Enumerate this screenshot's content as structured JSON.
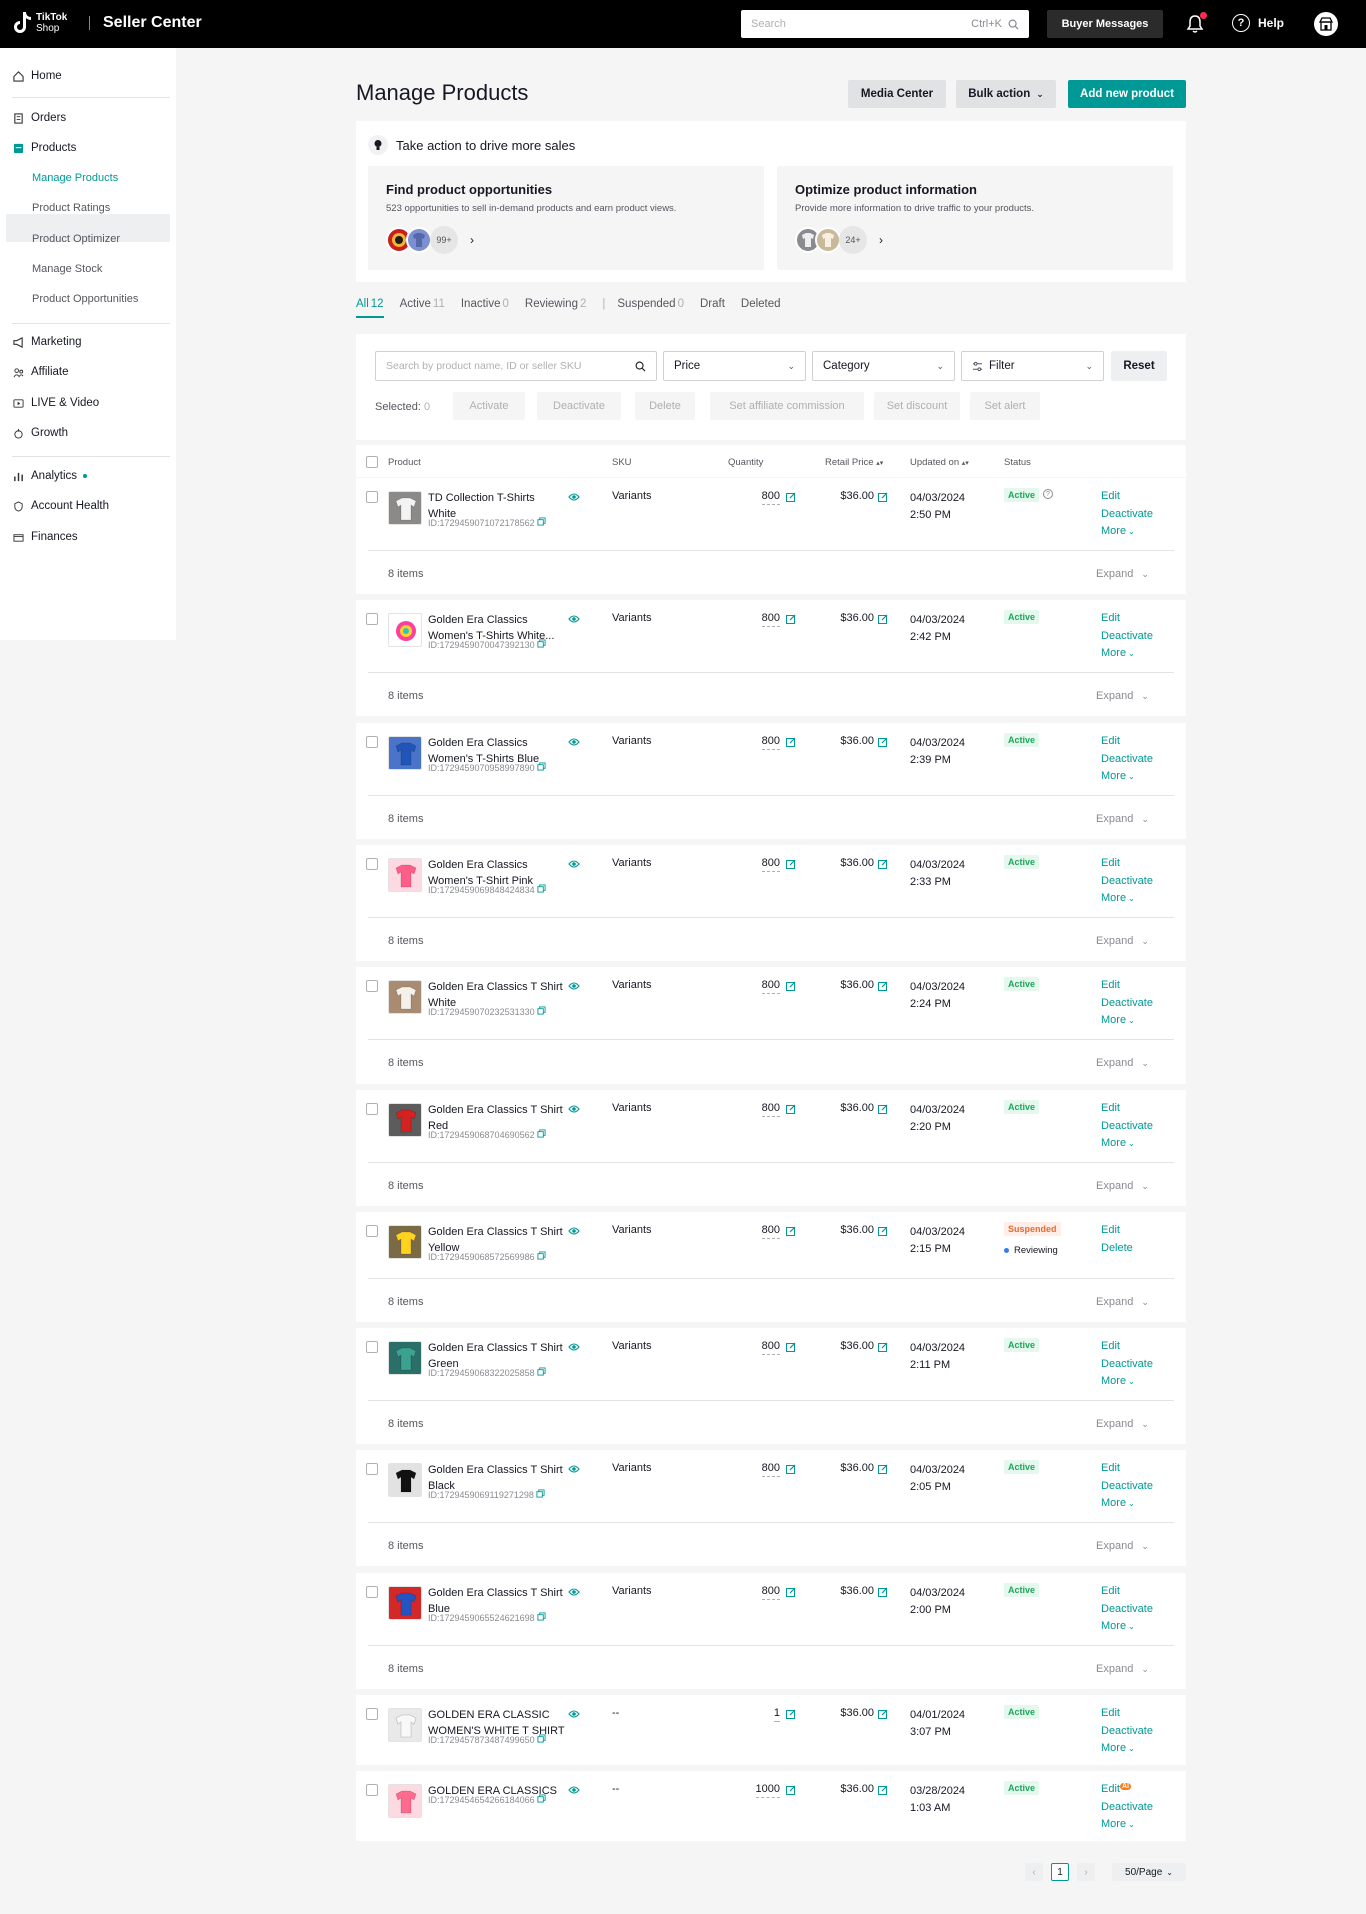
{
  "topbar": {
    "logo_line1": "TikTok",
    "logo_line2": "Shop",
    "title": "Seller Center",
    "search_placeholder": "Search",
    "search_shortcut": "Ctrl+K",
    "buyer_messages": "Buyer Messages",
    "help": "Help"
  },
  "sidebar": {
    "home": "Home",
    "orders": "Orders",
    "products": "Products",
    "products_sub": [
      "Manage Products",
      "Product Ratings",
      "Product Optimizer",
      "Manage Stock",
      "Product Opportunities"
    ],
    "marketing": "Marketing",
    "affiliate": "Affiliate",
    "live_video": "LIVE & Video",
    "growth": "Growth",
    "analytics": "Analytics",
    "account_health": "Account Health",
    "finances": "Finances"
  },
  "header": {
    "title": "Manage Products",
    "media_center": "Media Center",
    "bulk_action": "Bulk action",
    "add_new": "Add new product"
  },
  "promo": {
    "heading": "Take action to drive more sales",
    "cards": [
      {
        "title": "Find product opportunities",
        "desc": "523 opportunities to sell in-demand products and earn product views.",
        "count": "99+"
      },
      {
        "title": "Optimize product information",
        "desc": "Provide more information to drive traffic to your products.",
        "count": "24+"
      }
    ]
  },
  "tabs": [
    {
      "label": "All",
      "count": "12"
    },
    {
      "label": "Active",
      "count": "11"
    },
    {
      "label": "Inactive",
      "count": "0"
    },
    {
      "label": "Reviewing",
      "count": "2"
    },
    {
      "label": "Suspended",
      "count": "0"
    },
    {
      "label": "Draft",
      "count": ""
    },
    {
      "label": "Deleted",
      "count": ""
    }
  ],
  "filters": {
    "search_placeholder": "Search by product name, ID or seller SKU",
    "price": "Price",
    "category": "Category",
    "filter": "Filter",
    "reset": "Reset",
    "selected_label": "Selected:",
    "selected_count": "0",
    "bulk_buttons": [
      "Activate",
      "Deactivate",
      "Delete",
      "Set affiliate commission",
      "Set discount",
      "Set alert"
    ]
  },
  "table": {
    "headers": {
      "product": "Product",
      "sku": "SKU",
      "quantity": "Quantity",
      "retail_price": "Retail Price",
      "updated_on": "Updated on",
      "status": "Status"
    },
    "items_label": "8 items",
    "expand": "Expand",
    "rows": [
      {
        "name1": "TD Collection T-Shirts",
        "name2": "White",
        "id": "ID:1729459071072178562",
        "sku": "Variants",
        "qty": "800",
        "price": "$36.00",
        "date": "04/03/2024",
        "time": "2:50 PM",
        "status": "Active",
        "actions": [
          "Edit",
          "Deactivate",
          "More"
        ]
      },
      {
        "name1": "Golden Era Classics",
        "name2": "Women's T-Shirts White...",
        "id": "ID:1729459070047392130",
        "sku": "Variants",
        "qty": "800",
        "price": "$36.00",
        "date": "04/03/2024",
        "time": "2:42 PM",
        "status": "Active",
        "actions": [
          "Edit",
          "Deactivate",
          "More"
        ]
      },
      {
        "name1": "Golden Era Classics",
        "name2": "Women's T-Shirts Blue",
        "id": "ID:1729459070958997890",
        "sku": "Variants",
        "qty": "800",
        "price": "$36.00",
        "date": "04/03/2024",
        "time": "2:39 PM",
        "status": "Active",
        "actions": [
          "Edit",
          "Deactivate",
          "More"
        ]
      },
      {
        "name1": "Golden Era Classics",
        "name2": "Women's T-Shirt Pink",
        "id": "ID:1729459069848424834",
        "sku": "Variants",
        "qty": "800",
        "price": "$36.00",
        "date": "04/03/2024",
        "time": "2:33 PM",
        "status": "Active",
        "actions": [
          "Edit",
          "Deactivate",
          "More"
        ]
      },
      {
        "name1": "Golden Era Classics T Shirt",
        "name2": "White",
        "id": "ID:1729459070232531330",
        "sku": "Variants",
        "qty": "800",
        "price": "$36.00",
        "date": "04/03/2024",
        "time": "2:24 PM",
        "status": "Active",
        "actions": [
          "Edit",
          "Deactivate",
          "More"
        ]
      },
      {
        "name1": "Golden Era Classics T Shirt",
        "name2": "Red",
        "id": "ID:1729459068704690562",
        "sku": "Variants",
        "qty": "800",
        "price": "$36.00",
        "date": "04/03/2024",
        "time": "2:20 PM",
        "status": "Active",
        "actions": [
          "Edit",
          "Deactivate",
          "More"
        ]
      },
      {
        "name1": "Golden Era Classics T Shirt",
        "name2": "Yellow",
        "id": "ID:1729459068572569986",
        "sku": "Variants",
        "qty": "800",
        "price": "$36.00",
        "date": "04/03/2024",
        "time": "2:15 PM",
        "status": "Suspended",
        "substatus": "Reviewing",
        "actions": [
          "Edit",
          "Delete"
        ]
      },
      {
        "name1": "Golden Era Classics T Shirt",
        "name2": "Green",
        "id": "ID:1729459068322025858",
        "sku": "Variants",
        "qty": "800",
        "price": "$36.00",
        "date": "04/03/2024",
        "time": "2:11 PM",
        "status": "Active",
        "actions": [
          "Edit",
          "Deactivate",
          "More"
        ]
      },
      {
        "name1": "Golden Era Classics T Shirt",
        "name2": "Black",
        "id": "ID:1729459069119271298",
        "sku": "Variants",
        "qty": "800",
        "price": "$36.00",
        "date": "04/03/2024",
        "time": "2:05 PM",
        "status": "Active",
        "actions": [
          "Edit",
          "Deactivate",
          "More"
        ]
      },
      {
        "name1": "Golden Era Classics T Shirt",
        "name2": "Blue",
        "id": "ID:1729459065524621698",
        "sku": "Variants",
        "qty": "800",
        "price": "$36.00",
        "date": "04/03/2024",
        "time": "2:00 PM",
        "status": "Active",
        "actions": [
          "Edit",
          "Deactivate",
          "More"
        ]
      },
      {
        "name1": "GOLDEN ERA CLASSIC",
        "name2": "WOMEN'S WHITE T SHIRT",
        "id": "ID:1729457873487499650",
        "sku": "--",
        "qty": "1",
        "price": "$36.00",
        "date": "04/01/2024",
        "time": "3:07 PM",
        "status": "Active",
        "actions": [
          "Edit",
          "Deactivate",
          "More"
        ]
      },
      {
        "name1": "GOLDEN ERA CLASSICS",
        "name2": "",
        "id": "ID:1729454654266184066",
        "sku": "--",
        "qty": "1000",
        "price": "$36.00",
        "date": "03/28/2024",
        "time": "1:03 AM",
        "status": "Active",
        "ai_badge": "AI",
        "actions": [
          "Edit",
          "Deactivate",
          "More"
        ]
      }
    ]
  },
  "pagination": {
    "current": "1",
    "per_page": "50/Page"
  },
  "colors": {
    "accent": "#009995",
    "active_green": "#20a55c",
    "suspended_orange": "#e86b2f"
  }
}
